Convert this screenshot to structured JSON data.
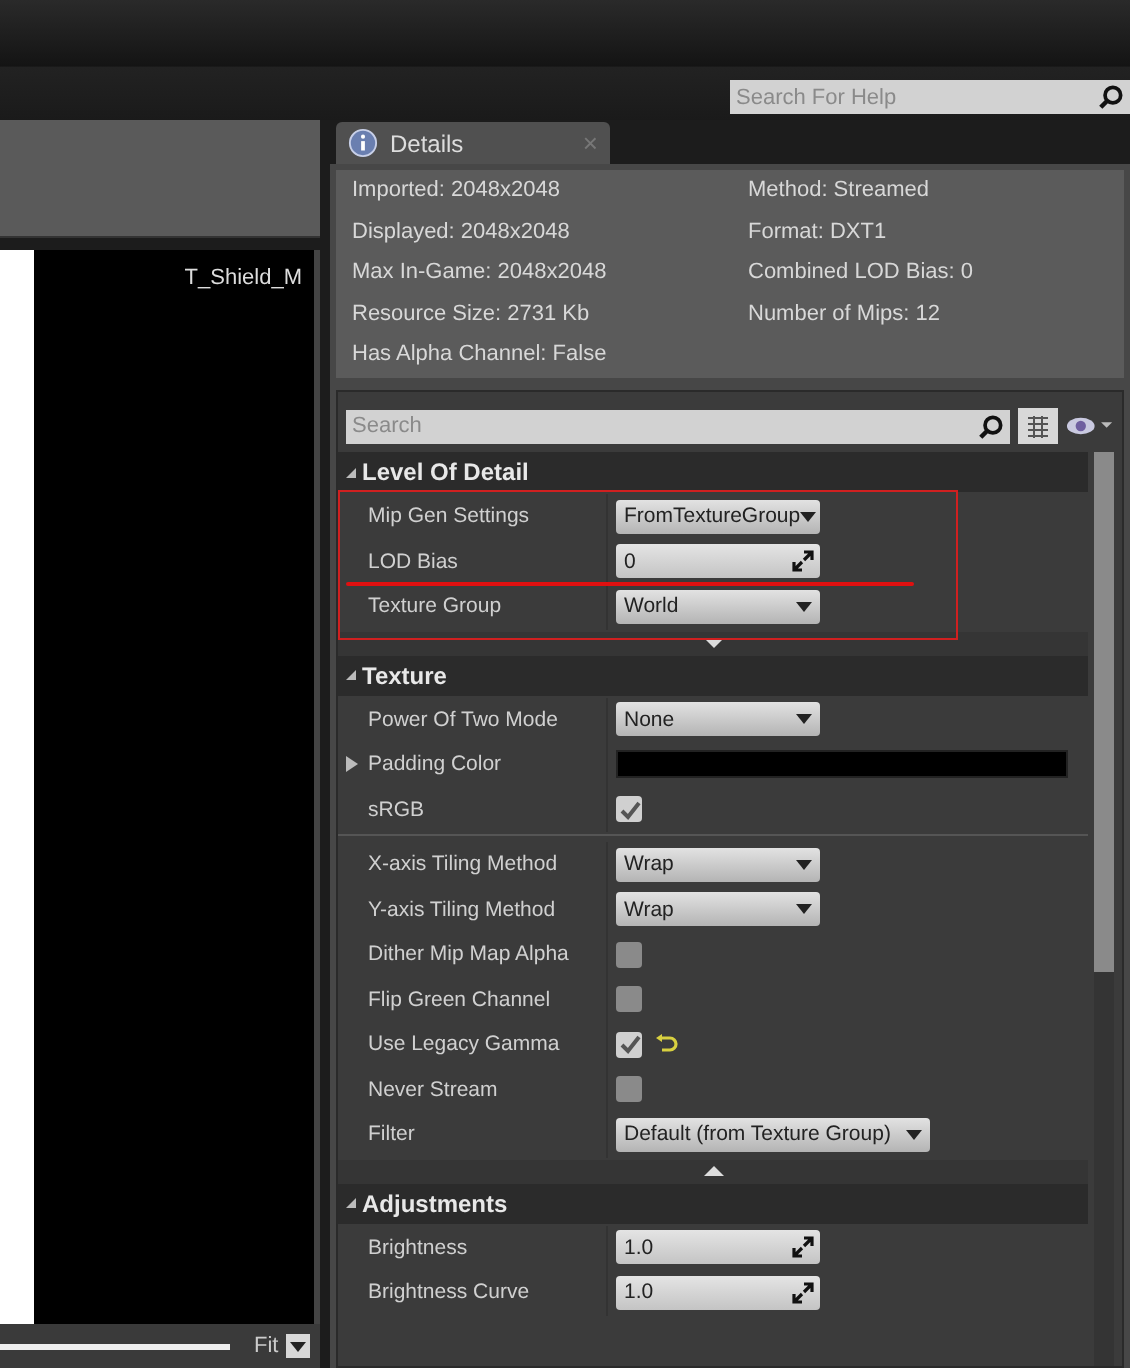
{
  "help_search": {
    "placeholder": "Search For Help"
  },
  "viewport": {
    "texture_name": "T_Shield_M",
    "zoom": "Fit"
  },
  "details_tab": {
    "title": "Details",
    "close": "×"
  },
  "info_left": [
    "Imported: 2048x2048",
    "Displayed: 2048x2048",
    "Max In-Game: 2048x2048",
    "Resource Size: 2731 Kb",
    "Has Alpha Channel: False"
  ],
  "info_right": [
    "Method: Streamed",
    "Format: DXT1",
    "Combined LOD Bias: 0",
    "Number of Mips: 12"
  ],
  "search": {
    "placeholder": "Search"
  },
  "sections": [
    {
      "title": "Level Of Detail",
      "expanded": true,
      "highlighted": true,
      "advanced_expanded": false,
      "rows": [
        {
          "kind": "dropdown",
          "label": "Mip Gen Settings",
          "value": "FromTextureGroup"
        },
        {
          "kind": "number",
          "label": "LOD Bias",
          "value": "0"
        },
        {
          "kind": "dropdown",
          "label": "Texture Group",
          "value": "World"
        }
      ]
    },
    {
      "title": "Texture",
      "expanded": true,
      "advanced_expanded": true,
      "rows": [
        {
          "kind": "dropdown",
          "label": "Power Of Two Mode",
          "value": "None"
        },
        {
          "kind": "color",
          "label": "Padding Color",
          "color": "#000000",
          "expanded": false
        },
        {
          "kind": "checkbox",
          "label": "sRGB",
          "checked": true,
          "reset": false
        }
      ],
      "advanced_rows": [
        {
          "kind": "dropdown",
          "label": "X-axis Tiling Method",
          "value": "Wrap"
        },
        {
          "kind": "dropdown",
          "label": "Y-axis Tiling Method",
          "value": "Wrap"
        },
        {
          "kind": "checkbox",
          "label": "Dither Mip Map Alpha",
          "checked": false,
          "reset": false
        },
        {
          "kind": "checkbox",
          "label": "Flip Green Channel",
          "checked": false,
          "reset": false
        },
        {
          "kind": "checkbox",
          "label": "Use Legacy Gamma",
          "checked": true,
          "reset": true
        },
        {
          "kind": "checkbox",
          "label": "Never Stream",
          "checked": false,
          "reset": false
        },
        {
          "kind": "dropdown",
          "label": "Filter",
          "value": "Default (from Texture Group)",
          "wide": true
        }
      ]
    },
    {
      "title": "Adjustments",
      "expanded": true,
      "rows": [
        {
          "kind": "number",
          "label": "Brightness",
          "value": "1.0"
        },
        {
          "kind": "number",
          "label": "Brightness Curve",
          "value": "1.0"
        }
      ]
    }
  ]
}
